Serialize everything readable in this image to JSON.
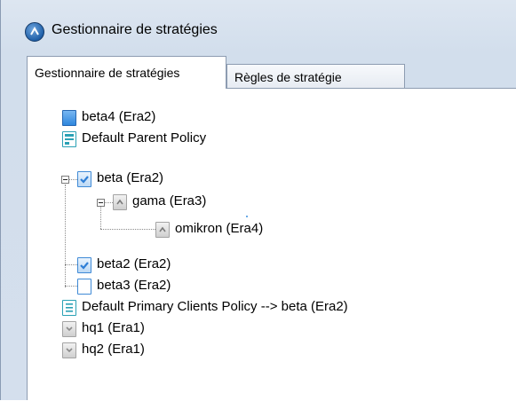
{
  "window": {
    "title": "Gestionnaire de stratégies"
  },
  "tabs": [
    {
      "label": "Gestionnaire de stratégies",
      "active": true
    },
    {
      "label": "Règles de stratégie",
      "active": false
    }
  ],
  "tree": {
    "items": [
      {
        "label": "beta4 (Era2)",
        "icon": "policy-blue-icon"
      },
      {
        "label": "Default Parent Policy",
        "icon": "policy-server-icon"
      },
      {
        "label": "beta (Era2)",
        "icon": "policy-check-icon",
        "expanded": true
      },
      {
        "label": "gama (Era3)",
        "icon": "policy-arrow-gray-icon",
        "expanded": true
      },
      {
        "label": "omikron (Era4)",
        "icon": "policy-arrow-gray-icon"
      },
      {
        "label": "beta2 (Era2)",
        "icon": "policy-check-icon"
      },
      {
        "label": "beta3 (Era2)",
        "icon": "policy-white-icon"
      },
      {
        "label": "Default Primary Clients Policy  --> beta (Era2)",
        "icon": "policy-document-icon"
      },
      {
        "label": "hq1 (Era1)",
        "icon": "policy-gray-check-icon"
      },
      {
        "label": "hq2 (Era1)",
        "icon": "policy-gray-check-icon"
      }
    ]
  },
  "colors": {
    "window_bg": "#d4dfed",
    "policy_blue": "#2f86dd",
    "policy_teal": "#2aa1b5"
  }
}
